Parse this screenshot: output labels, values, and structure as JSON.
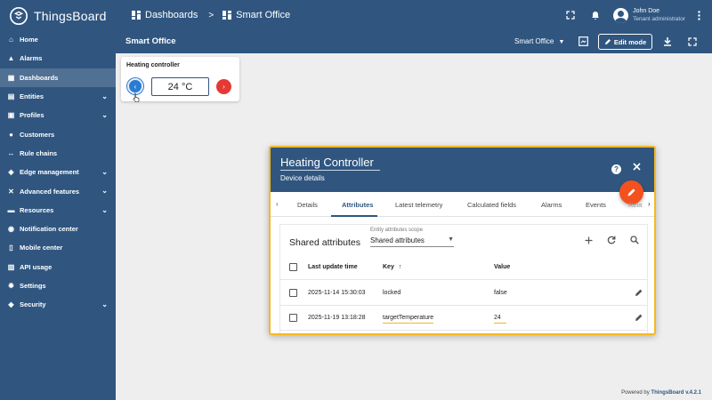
{
  "app": {
    "name": "ThingsBoard",
    "version": "v.4.2.1"
  },
  "breadcrumb": {
    "parent": "Dashboards",
    "separator": ">",
    "current": "Smart Office"
  },
  "user": {
    "name": "John Doe",
    "role": "Tenant administrator"
  },
  "sidebar": {
    "items": [
      {
        "label": "Home",
        "icon": "home-icon",
        "chevron": false,
        "active": false
      },
      {
        "label": "Alarms",
        "icon": "bell-icon",
        "chevron": false,
        "active": false
      },
      {
        "label": "Dashboards",
        "icon": "dashboard-icon",
        "chevron": false,
        "active": true
      },
      {
        "label": "Entities",
        "icon": "entities-icon",
        "chevron": true,
        "active": false
      },
      {
        "label": "Profiles",
        "icon": "profiles-icon",
        "chevron": true,
        "active": false
      },
      {
        "label": "Customers",
        "icon": "customers-icon",
        "chevron": false,
        "active": false
      },
      {
        "label": "Rule chains",
        "icon": "rule-chains-icon",
        "chevron": false,
        "active": false
      },
      {
        "label": "Edge management",
        "icon": "edge-icon",
        "chevron": true,
        "active": false
      },
      {
        "label": "Advanced features",
        "icon": "tools-icon",
        "chevron": true,
        "active": false
      },
      {
        "label": "Resources",
        "icon": "folder-icon",
        "chevron": true,
        "active": false
      },
      {
        "label": "Notification center",
        "icon": "notification-icon",
        "chevron": false,
        "active": false
      },
      {
        "label": "Mobile center",
        "icon": "mobile-icon",
        "chevron": false,
        "active": false
      },
      {
        "label": "API usage",
        "icon": "api-usage-icon",
        "chevron": false,
        "active": false
      },
      {
        "label": "Settings",
        "icon": "gear-icon",
        "chevron": false,
        "active": false
      },
      {
        "label": "Security",
        "icon": "shield-icon",
        "chevron": true,
        "active": false
      }
    ]
  },
  "dashboard": {
    "title": "Smart Office",
    "state": "Smart Office",
    "edit_label": "Edit mode"
  },
  "widget": {
    "title": "Heating controller",
    "value": "24 °C"
  },
  "dialog": {
    "title": "Heating Controller",
    "subtitle": "Device details",
    "tabs": [
      {
        "label": "Details",
        "active": false
      },
      {
        "label": "Attributes",
        "active": true
      },
      {
        "label": "Latest telemetry",
        "active": false
      },
      {
        "label": "Calculated fields",
        "active": false
      },
      {
        "label": "Alarms",
        "active": false
      },
      {
        "label": "Events",
        "active": false
      },
      {
        "label": "Relations",
        "active": false
      }
    ],
    "panel": {
      "title": "Shared attributes",
      "scope_label": "Entity attributes scope",
      "scope_value": "Shared attributes",
      "columns": {
        "time": "Last update time",
        "key": "Key",
        "value": "Value",
        "sort_arrow": "↑"
      },
      "rows": [
        {
          "time": "2025-11-14 15:30:03",
          "key": "locked",
          "value": "false"
        },
        {
          "time": "2025-11-19 13:18:28",
          "key": "targetTemperature",
          "value": "24"
        }
      ]
    }
  },
  "footer": {
    "prefix": "Powered by",
    "brand": "ThingsBoard v.4.2.1"
  },
  "colors": {
    "primary": "#305680",
    "accent": "#f4511e",
    "highlight": "#f5b822",
    "left_button": "#2a7bd2",
    "right_button": "#e53935"
  }
}
